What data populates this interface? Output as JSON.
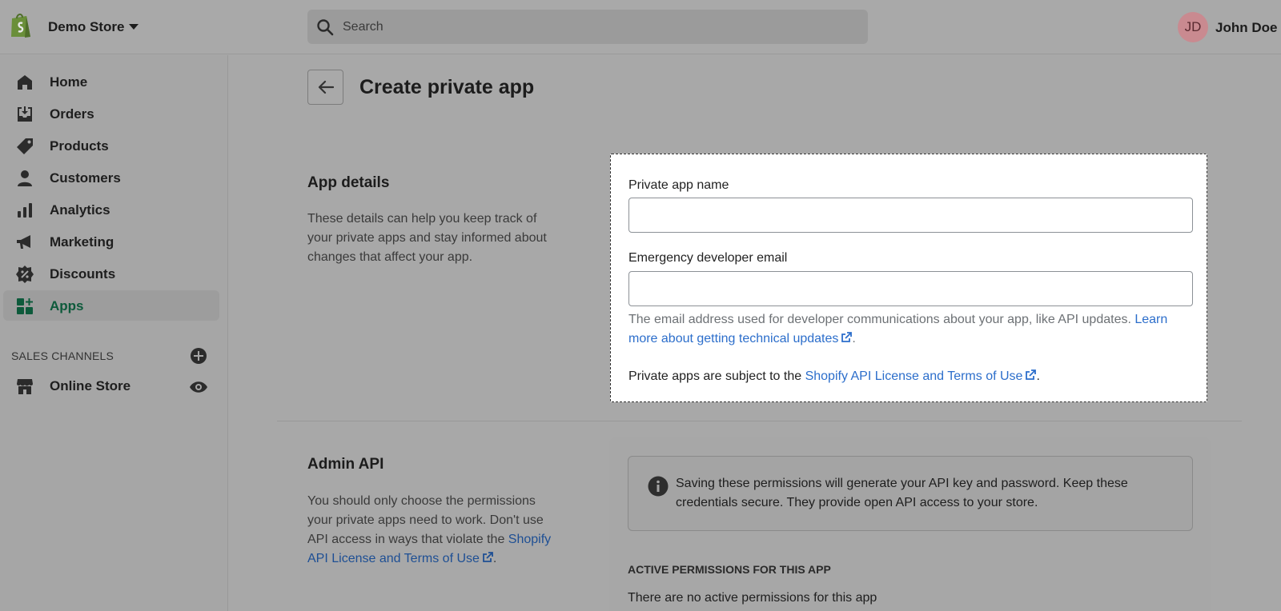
{
  "topbar": {
    "store_name": "Demo Store",
    "search_placeholder": "Search",
    "user_initials": "JD",
    "user_name": "John Doe"
  },
  "sidebar": {
    "items": [
      {
        "label": "Home",
        "icon": "home-icon"
      },
      {
        "label": "Orders",
        "icon": "orders-icon"
      },
      {
        "label": "Products",
        "icon": "tag-icon"
      },
      {
        "label": "Customers",
        "icon": "person-icon"
      },
      {
        "label": "Analytics",
        "icon": "bar-chart-icon"
      },
      {
        "label": "Marketing",
        "icon": "megaphone-icon"
      },
      {
        "label": "Discounts",
        "icon": "discount-icon"
      },
      {
        "label": "Apps",
        "icon": "apps-icon",
        "active": true
      }
    ],
    "sales_channels_title": "SALES CHANNELS",
    "online_store_label": "Online Store"
  },
  "page": {
    "title": "Create private app"
  },
  "app_details": {
    "title": "App details",
    "description": "These details can help you keep track of your private apps and stay informed about changes that affect your app.",
    "name_label": "Private app name",
    "name_value": "",
    "email_label": "Emergency developer email",
    "email_value": "",
    "email_help": "The email address used for developer communications about your app, like API updates. ",
    "email_help_link": "Learn more about getting technical updates",
    "terms_prefix": "Private apps are subject to the ",
    "terms_link": "Shopify API License and Terms of Use",
    "period": "."
  },
  "admin_api": {
    "title": "Admin API",
    "description": "You should only choose the permissions your private apps need to work. Don't use API access in ways that violate the ",
    "description_link": "Shopify API License and Terms of Use",
    "banner_text": "Saving these permissions will generate your API key and password. Keep these credentials secure. They provide open API access to your store.",
    "permissions_title": "ACTIVE PERMISSIONS FOR THIS APP",
    "permissions_empty": "There are no active permissions for this app"
  },
  "colors": {
    "accent_green": "#0d5a3b",
    "link_blue": "#2c6ecb",
    "avatar_bg": "#c98a90"
  }
}
